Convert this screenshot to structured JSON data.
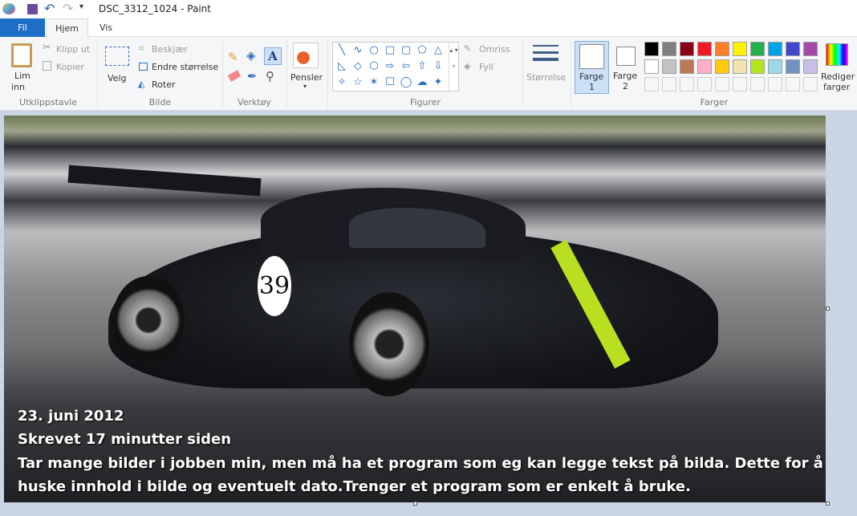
{
  "window": {
    "title": "DSC_3312_1024 - Paint"
  },
  "tabs": [
    {
      "label": "Fil"
    },
    {
      "label": "Hjem"
    },
    {
      "label": "Vis"
    }
  ],
  "clipboard": {
    "paste": "Lim",
    "paste2": "inn",
    "cut": "Klipp ut",
    "copy": "Kopier",
    "group": "Utklippstavle"
  },
  "image": {
    "select": "Velg",
    "crop": "Beskjær",
    "resize": "Endre størrelse",
    "rotate": "Roter",
    "group": "Bilde"
  },
  "tools": {
    "group": "Verktøy"
  },
  "brushes": {
    "label": "Pensler"
  },
  "shapes": {
    "outline": "Omriss",
    "fill": "Fyll",
    "group": "Figurer",
    "glyphs": [
      "╲",
      "∿",
      "○",
      "□",
      "▢",
      "⬠",
      "△",
      "◺",
      "◇",
      "⬡",
      "⇨",
      "⇦",
      "⇧",
      "⇩",
      "✧",
      "☆",
      "✶",
      "☐",
      "◯",
      "☁",
      "✦",
      "⬢",
      "◠",
      "♡"
    ]
  },
  "size": {
    "label": "Størrelse"
  },
  "colors": {
    "color1": "Farge",
    "color1n": "1",
    "color2": "Farge",
    "color2n": "2",
    "edit": "Rediger",
    "edit2": "farger",
    "group": "Farger",
    "palette": [
      "#000000",
      "#7f7f7f",
      "#880015",
      "#ed1c24",
      "#ff7f27",
      "#fff200",
      "#22b14c",
      "#00a2e8",
      "#3f48cc",
      "#a349a4",
      "#ffffff",
      "#c3c3c3",
      "#b97a57",
      "#ffaec9",
      "#ffc90e",
      "#efe4b0",
      "#b5e61d",
      "#99d9ea",
      "#7092be",
      "#c8bfe7"
    ]
  },
  "caption": {
    "line1": "23. juni 2012",
    "line2": "Skrevet 17 minutter siden",
    "line3": "Tar mange bilder i jobben min, men må ha et program som eg kan legge tekst på bilda. Dette for å",
    "line4": "huske innhold i bilde og eventuelt dato.Trenger et program som er enkelt å bruke."
  },
  "photo": {
    "number": "39"
  }
}
